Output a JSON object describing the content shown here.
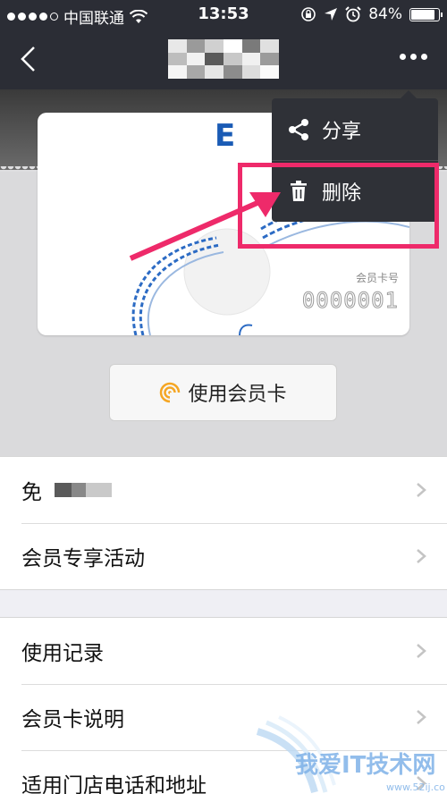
{
  "status_bar": {
    "carrier": "中国联通",
    "time": "13:53",
    "battery": "84%",
    "battery_level": 0.84,
    "icons": [
      "signal-dots-icon",
      "wifi-icon",
      "rotation-lock-icon",
      "location-arrow-icon",
      "alarm-icon",
      "battery-icon"
    ]
  },
  "nav": {
    "back_icon": "chevron-left-icon",
    "title_redacted": true,
    "more_icon": "more-dots-icon"
  },
  "card": {
    "logo": "E",
    "number_label": "会员卡号",
    "number": "0000001"
  },
  "use_card_button": {
    "label": "使用会员卡",
    "icon": "signal-circle-icon"
  },
  "list1": [
    {
      "label": "免"
    },
    {
      "label": "会员专享活动"
    }
  ],
  "list2": [
    {
      "label": "使用记录"
    },
    {
      "label": "会员卡说明"
    },
    {
      "label": "适用门店电话和地址"
    }
  ],
  "menu": {
    "share": {
      "label": "分享",
      "icon": "share-icon"
    },
    "delete": {
      "label": "删除",
      "icon": "trash-icon"
    }
  },
  "colors": {
    "nav_bg": "#2b2d35",
    "highlight": "#ee2a6a",
    "card_logo": "#1a5bb5",
    "use_icon": "#f5a623"
  }
}
